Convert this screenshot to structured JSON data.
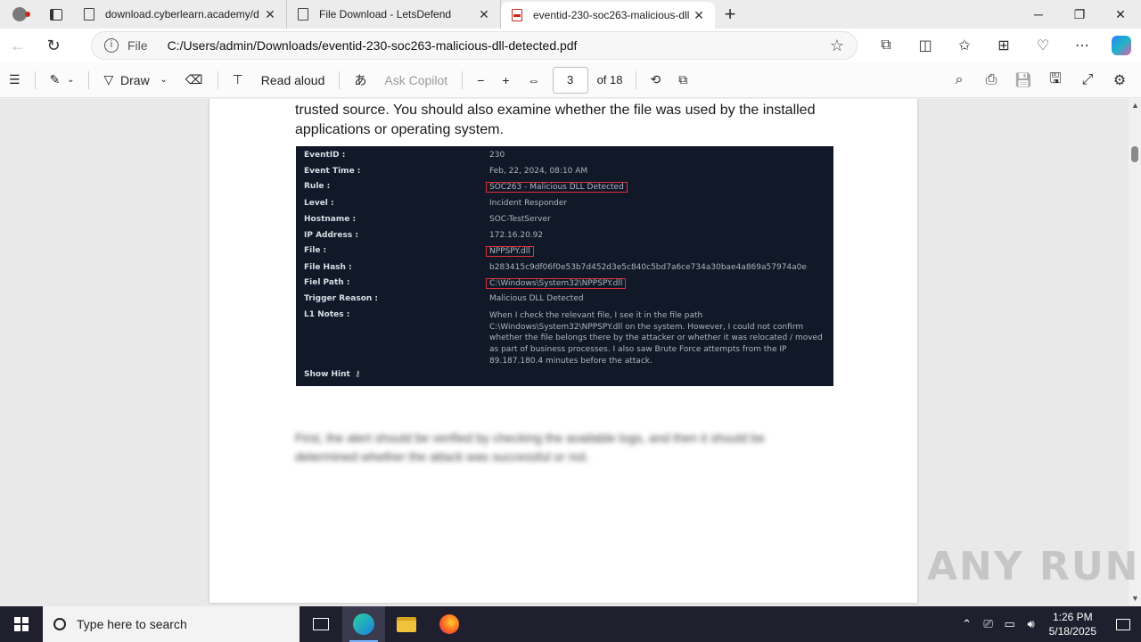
{
  "tabs": [
    {
      "title": "download.cyberlearn.academy/d",
      "active": false
    },
    {
      "title": "File Download - LetsDefend",
      "active": false
    },
    {
      "title": "eventid-230-soc263-malicious-dll",
      "active": true
    }
  ],
  "address": {
    "scheme_label": "File",
    "url": "C:/Users/admin/Downloads/eventid-230-soc263-malicious-dll-detected.pdf"
  },
  "pdf_toolbar": {
    "draw_label": "Draw",
    "read_aloud_label": "Read aloud",
    "ask_copilot_label": "Ask Copilot",
    "current_page": "3",
    "of_pages": "of 18"
  },
  "document": {
    "paragraph": "digital signature of the file to determine its origin and ensure that it comes from a trusted source. You should also examine whether the file was used by the installed applications or operating system.",
    "alert": {
      "rows": [
        {
          "key": "EventID :",
          "value": "230",
          "boxed": false
        },
        {
          "key": "Event Time :",
          "value": "Feb, 22, 2024, 08:10 AM",
          "boxed": false
        },
        {
          "key": "Rule :",
          "value": "SOC263 - Malicious DLL Detected",
          "boxed": true
        },
        {
          "key": "Level :",
          "value": "Incident Responder",
          "boxed": false
        },
        {
          "key": "Hostname :",
          "value": "SOC-TestServer",
          "boxed": false
        },
        {
          "key": "IP Address :",
          "value": "172.16.20.92",
          "boxed": false
        },
        {
          "key": "File :",
          "value": "NPPSPY.dll",
          "boxed": true
        },
        {
          "key": "File Hash :",
          "value": "b283415c9df06f0e53b7d452d3e5c840c5bd7a6ce734a30bae4a869a57974a0e",
          "boxed": false
        },
        {
          "key": "Fiel Path :",
          "value": "C:\\Windows\\System32\\NPPSPY.dll",
          "boxed": true
        },
        {
          "key": "Trigger Reason :",
          "value": "Malicious DLL Detected",
          "boxed": false
        }
      ],
      "notes_key": "L1 Notes :",
      "notes": "When I check the relevant file, I see it in the file path C:\\Windows\\System32\\NPPSPY.dll on the system. However, I could not confirm whether the file belongs there by the attacker or whether it was relocated / moved as part of business processes. I also saw Brute Force attempts from the IP 89.187.180.4 minutes before the attack.",
      "hint_label": "Show Hint"
    },
    "blurred_text": "First, the alert should be verified by checking the available logs, and then it should be determined whether the attack was successful or not."
  },
  "watermark": "ANY RUN",
  "taskbar": {
    "search_placeholder": "Type here to search",
    "time": "1:26 PM",
    "date": "5/18/2025"
  }
}
